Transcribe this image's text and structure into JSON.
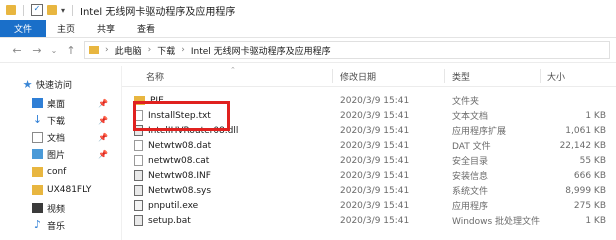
{
  "window": {
    "title": "Intel 无线网卡驱动程序及应用程序"
  },
  "ribbon": {
    "tabs": [
      "文件",
      "主页",
      "共享",
      "查看"
    ]
  },
  "address": {
    "crumbs": [
      "此电脑",
      "下载",
      "Intel 无线网卡驱动程序及应用程序"
    ]
  },
  "sidebar": {
    "quick_access": "快速访问",
    "items": [
      {
        "label": "桌面",
        "icon": "desktop-icon",
        "pinned": true
      },
      {
        "label": "下载",
        "icon": "download-icon",
        "pinned": true
      },
      {
        "label": "文档",
        "icon": "document-icon",
        "pinned": true
      },
      {
        "label": "图片",
        "icon": "picture-icon",
        "pinned": true
      },
      {
        "label": "conf",
        "icon": "folder-icon",
        "pinned": false
      },
      {
        "label": "UX481FLY",
        "icon": "folder-icon",
        "pinned": false
      },
      {
        "label": "视频",
        "icon": "video-icon",
        "pinned": false
      },
      {
        "label": "音乐",
        "icon": "music-icon",
        "pinned": false
      }
    ]
  },
  "columns": {
    "name": "名称",
    "date": "修改日期",
    "type": "类型",
    "size": "大小"
  },
  "files": [
    {
      "name": "PIE",
      "date": "2020/3/9 15:41",
      "type": "文件夹",
      "size": "",
      "icon": "folder-icon"
    },
    {
      "name": "InstallStep.txt",
      "date": "2020/3/9 15:41",
      "type": "文本文档",
      "size": "1 KB",
      "icon": "text-file-icon"
    },
    {
      "name": "IntelIHVRouter08.dll",
      "date": "2020/3/9 15:41",
      "type": "应用程序扩展",
      "size": "1,061 KB",
      "icon": "dll-file-icon"
    },
    {
      "name": "Netwtw08.dat",
      "date": "2020/3/9 15:41",
      "type": "DAT 文件",
      "size": "22,142 KB",
      "icon": "file-icon"
    },
    {
      "name": "netwtw08.cat",
      "date": "2020/3/9 15:41",
      "type": "安全目录",
      "size": "55 KB",
      "icon": "catalog-file-icon"
    },
    {
      "name": "Netwtw08.INF",
      "date": "2020/3/9 15:41",
      "type": "安装信息",
      "size": "666 KB",
      "icon": "inf-file-icon"
    },
    {
      "name": "Netwtw08.sys",
      "date": "2020/3/9 15:41",
      "type": "系统文件",
      "size": "8,999 KB",
      "icon": "sys-file-icon"
    },
    {
      "name": "pnputil.exe",
      "date": "2020/3/9 15:41",
      "type": "应用程序",
      "size": "275 KB",
      "icon": "exe-file-icon"
    },
    {
      "name": "setup.bat",
      "date": "2020/3/9 15:41",
      "type": "Windows 批处理文件",
      "size": "1 KB",
      "icon": "bat-file-icon"
    }
  ],
  "colors": {
    "accent": "#1a6fc9",
    "highlight": "#e0211f",
    "folder": "#e8b640"
  }
}
